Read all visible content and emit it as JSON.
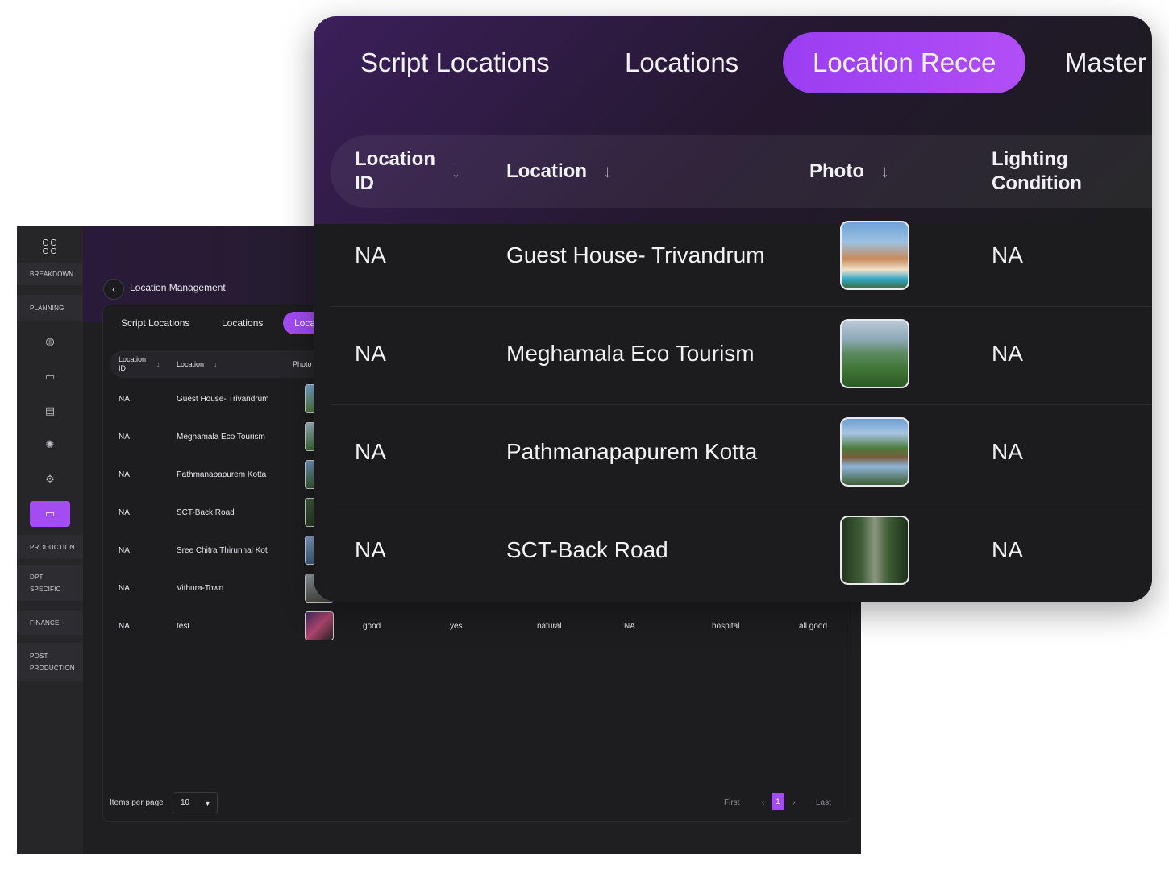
{
  "sidebar": {
    "sections": [
      "BREAKDOWN",
      "PLANNING",
      "PRODUCTION",
      "DPT SPECIFIC",
      "FINANCE",
      "POST PRODUCTION"
    ],
    "icons": [
      "grid-icon",
      "globe-icon",
      "monitor-icon",
      "document-icon",
      "bulb-icon",
      "settings-icon",
      "folder-icon"
    ]
  },
  "breadcrumb": {
    "back_glyph": "‹",
    "title": "Location Management"
  },
  "tabs": [
    {
      "label": "Script Locations"
    },
    {
      "label": "Locations"
    },
    {
      "label": "Location Recce"
    },
    {
      "label": "Master"
    }
  ],
  "background_tabs": {
    "active_partial": "Loca"
  },
  "columns": {
    "location_id": "Location ID",
    "location": "Location",
    "photo": "Photo",
    "lighting": "Lighting Condition",
    "sort_glyph": "↓"
  },
  "background_columns": {
    "location_id": "Location ID",
    "location": "Location",
    "photo": "Photo"
  },
  "rows": [
    {
      "id": "NA",
      "location": "Guest House- Trivandrum",
      "lighting": "NA",
      "photo_icon": "house-photo"
    },
    {
      "id": "NA",
      "location": "Meghamala Eco Tourism",
      "lighting": "NA",
      "photo_icon": "hills-photo"
    },
    {
      "id": "NA",
      "location": "Pathmanapapurem Kotta",
      "lighting": "NA",
      "photo_icon": "pond-photo"
    },
    {
      "id": "NA",
      "location": "SCT-Back Road",
      "lighting": "NA",
      "photo_icon": "forest-road-photo"
    }
  ],
  "background_rows": [
    {
      "id": "NA",
      "location": "Guest House- Trivandrum"
    },
    {
      "id": "NA",
      "location": "Meghamala Eco Tourism"
    },
    {
      "id": "NA",
      "location": "Pathmanapapurem Kotta"
    },
    {
      "id": "NA",
      "location": "SCT-Back Road"
    },
    {
      "id": "NA",
      "location": "Sree Chitra Thirunnal Kot"
    },
    {
      "id": "NA",
      "location": "Vithura-Town"
    },
    {
      "id": "NA",
      "location": "test",
      "c1": "good",
      "c2": "yes",
      "c3": "natural",
      "c4": "NA",
      "c5": "hospital",
      "c6": "all good"
    }
  ],
  "pagination": {
    "items_per_page_label": "Items per page",
    "items_per_page_value": "10",
    "caret": "▼",
    "first": "First",
    "prev": "‹",
    "current": "1",
    "next": "›",
    "last": "Last"
  },
  "colors": {
    "accent": "#a24cf2",
    "background": "#1c1c1f"
  }
}
